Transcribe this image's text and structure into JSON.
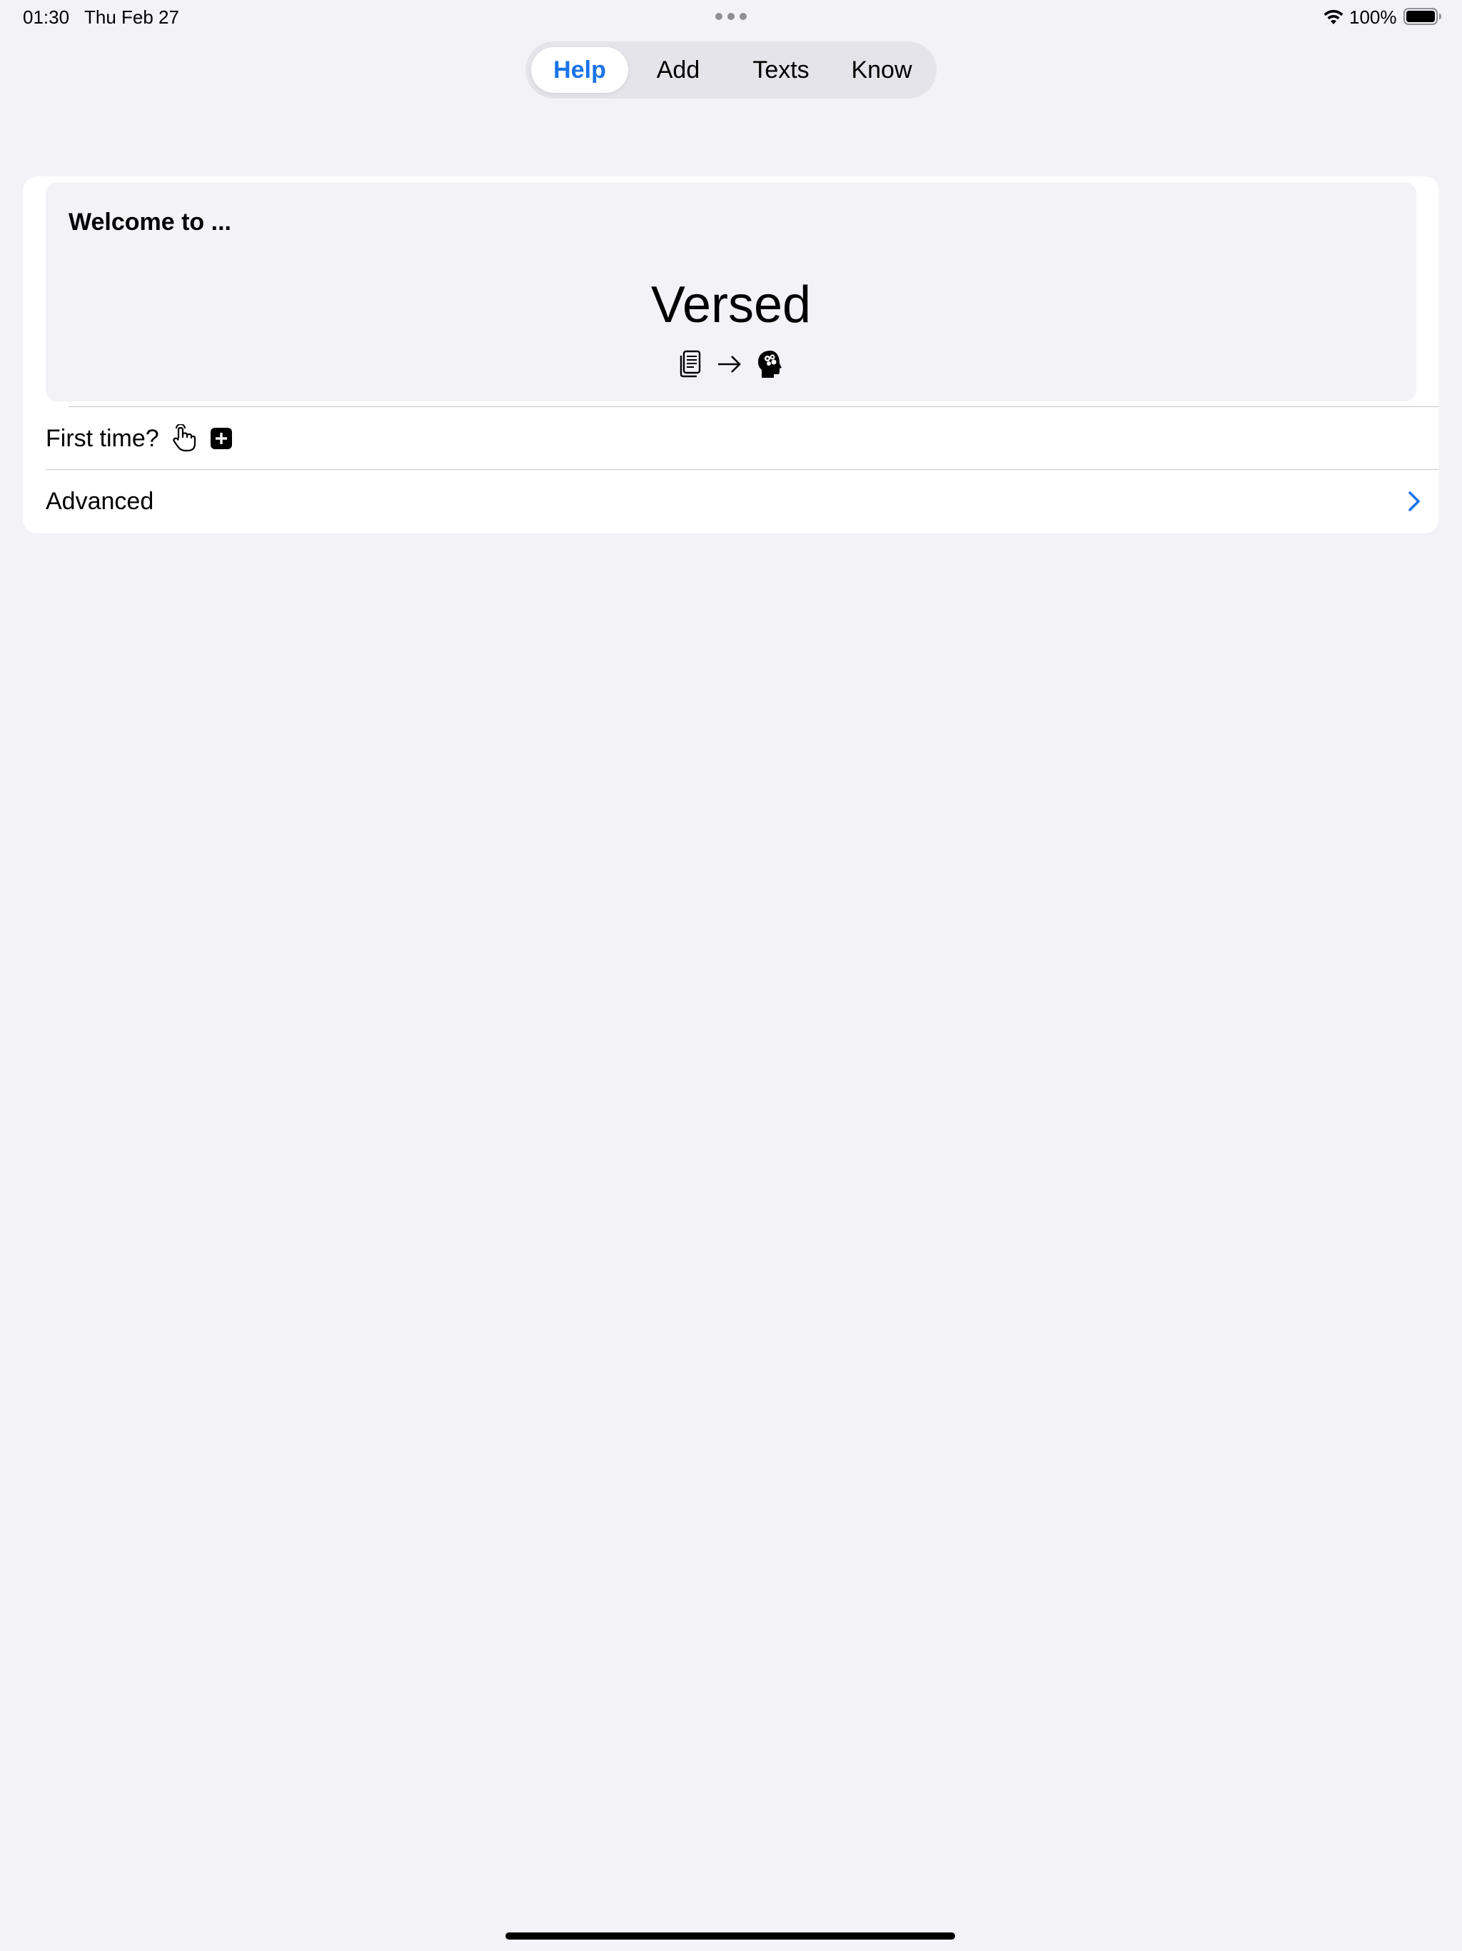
{
  "status_bar": {
    "time": "01:30",
    "date": "Thu Feb 27",
    "battery_percent": "100%",
    "wifi_icon": "wifi-icon",
    "battery_icon": "battery-full-icon"
  },
  "tabs": [
    {
      "label": "Help",
      "active": true
    },
    {
      "label": "Add",
      "active": false
    },
    {
      "label": "Texts",
      "active": false
    },
    {
      "label": "Know",
      "active": false
    }
  ],
  "hero": {
    "welcome": "Welcome to ...",
    "app_name": "Versed",
    "icons": [
      "document-icon",
      "arrow-right-icon",
      "brain-head-icon"
    ]
  },
  "rows": {
    "first_time": {
      "label": "First time?",
      "icons": [
        "tap-hand-icon",
        "plus-square-icon"
      ]
    },
    "advanced": {
      "label": "Advanced",
      "icon": "chevron-right-icon"
    }
  },
  "colors": {
    "accent": "#1a73e8",
    "background": "#f2f2f7",
    "card": "#ffffff",
    "segment_track": "#e4e4ea"
  }
}
